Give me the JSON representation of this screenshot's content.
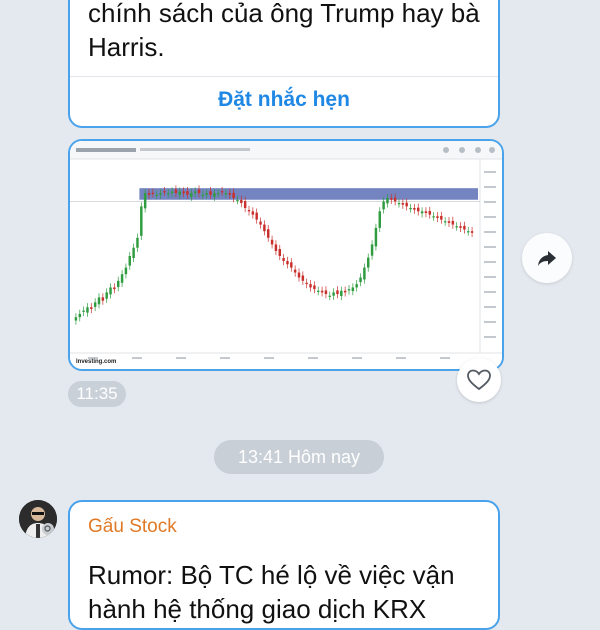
{
  "messages": {
    "first": {
      "text": "chính sách của ông Trump hay bà Harris.",
      "action_label": "Đặt nhắc hẹn"
    },
    "chart_message": {
      "time": "11:35",
      "chart_data": {
        "type": "candlestick",
        "brand": "Investing.com",
        "x": [
          1,
          2,
          3,
          4,
          5,
          6,
          7,
          8,
          9,
          10,
          11,
          12,
          13,
          14,
          15,
          16,
          17,
          18,
          19,
          20,
          21,
          22,
          23,
          24,
          25,
          26,
          27,
          28,
          29,
          30,
          31,
          32,
          33,
          34,
          35,
          36,
          37,
          38,
          39,
          40,
          41,
          42,
          43,
          44,
          45,
          46,
          47,
          48,
          49,
          50,
          51,
          52,
          53,
          54,
          55,
          56,
          57,
          58,
          59,
          60,
          61,
          62,
          63,
          64,
          65,
          66,
          67,
          68,
          69,
          70,
          71,
          72,
          73,
          74,
          75,
          76,
          77,
          78,
          79,
          80,
          81,
          82,
          83,
          84,
          85,
          86,
          87,
          88,
          89,
          90,
          91,
          92,
          93,
          94,
          95,
          96,
          97,
          98,
          99,
          100,
          101,
          102,
          103,
          104
        ],
        "values": [
          18,
          20,
          22,
          24,
          23,
          27,
          30,
          28,
          33,
          36,
          35,
          40,
          44,
          48,
          55,
          60,
          66,
          85,
          93,
          92,
          93,
          92,
          93,
          94,
          93,
          94,
          93,
          94,
          93,
          92,
          93,
          94,
          93,
          92,
          93,
          92,
          93,
          93,
          94,
          93,
          92,
          90,
          89,
          87,
          84,
          82,
          80,
          77,
          74,
          70,
          66,
          62,
          58,
          55,
          52,
          50,
          48,
          45,
          42,
          40,
          38,
          36,
          35,
          34,
          33,
          32,
          31,
          33,
          32,
          34,
          33,
          35,
          36,
          38,
          42,
          48,
          54,
          62,
          72,
          82,
          88,
          90,
          89,
          88,
          87,
          86,
          85,
          84,
          83,
          82,
          82,
          81,
          80,
          79,
          78,
          77,
          76,
          75,
          74,
          73,
          72,
          71,
          70,
          69
        ],
        "zone_low": 89,
        "zone_high": 96,
        "ylim": [
          0,
          110
        ]
      }
    },
    "date_separator": "13:41 Hôm nay",
    "third": {
      "sender": "Gấu Stock",
      "text": "Rumor: Bộ TC hé lộ về việc vận hành hệ thống giao dịch KRX"
    }
  },
  "icons": {
    "forward": "forward-arrow-icon",
    "heart": "heart-outline-icon",
    "avatar": "user-avatar"
  },
  "colors": {
    "bubble_border": "#4aa3ea",
    "link": "#1f88e5",
    "sender": "#e07a26",
    "candle_up": "#2e9c3f",
    "candle_down": "#c9302c",
    "zone": "#5a6fb5"
  }
}
